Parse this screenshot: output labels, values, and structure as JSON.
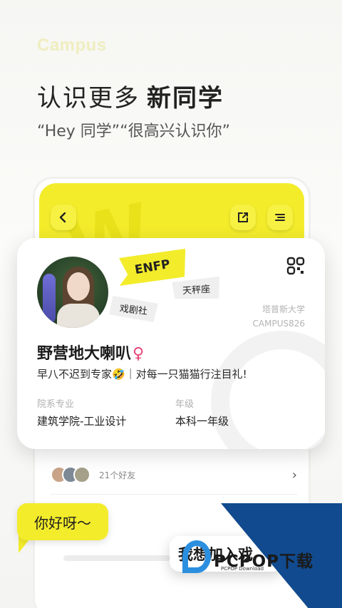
{
  "brand": "Campus",
  "headline": {
    "normal": "认识更多",
    "bold": "新同学"
  },
  "subline": "“Hey 同学”“很高兴认识你”",
  "phone": {
    "friends_count_text": "21个好友",
    "header_icons": [
      "back-icon",
      "share-icon",
      "menu-icon"
    ]
  },
  "profile": {
    "mbti": "ENFP",
    "tags": [
      "天秤座",
      "戏剧社"
    ],
    "school_name": "塔普斯大学",
    "school_id": "CAMPUS826",
    "name": "野营地大喇叭",
    "gender_symbol": "♀",
    "bio": "早八不迟到专家🤣｜对每一只猫猫行注目礼!",
    "fields": [
      {
        "label": "院系专业",
        "value": "建筑学院-工业设计"
      },
      {
        "label": "年级",
        "value": "本科一年级"
      }
    ]
  },
  "bubble_text": "你好呀～",
  "join_button": "我想加入戏",
  "watermark": {
    "text": "PCPOP下载",
    "sub": "PCPOP Download"
  },
  "colors": {
    "accent_yellow": "#f3ec2b",
    "gender_pink": "#e8457a",
    "watermark_blue": "#114a8e"
  }
}
